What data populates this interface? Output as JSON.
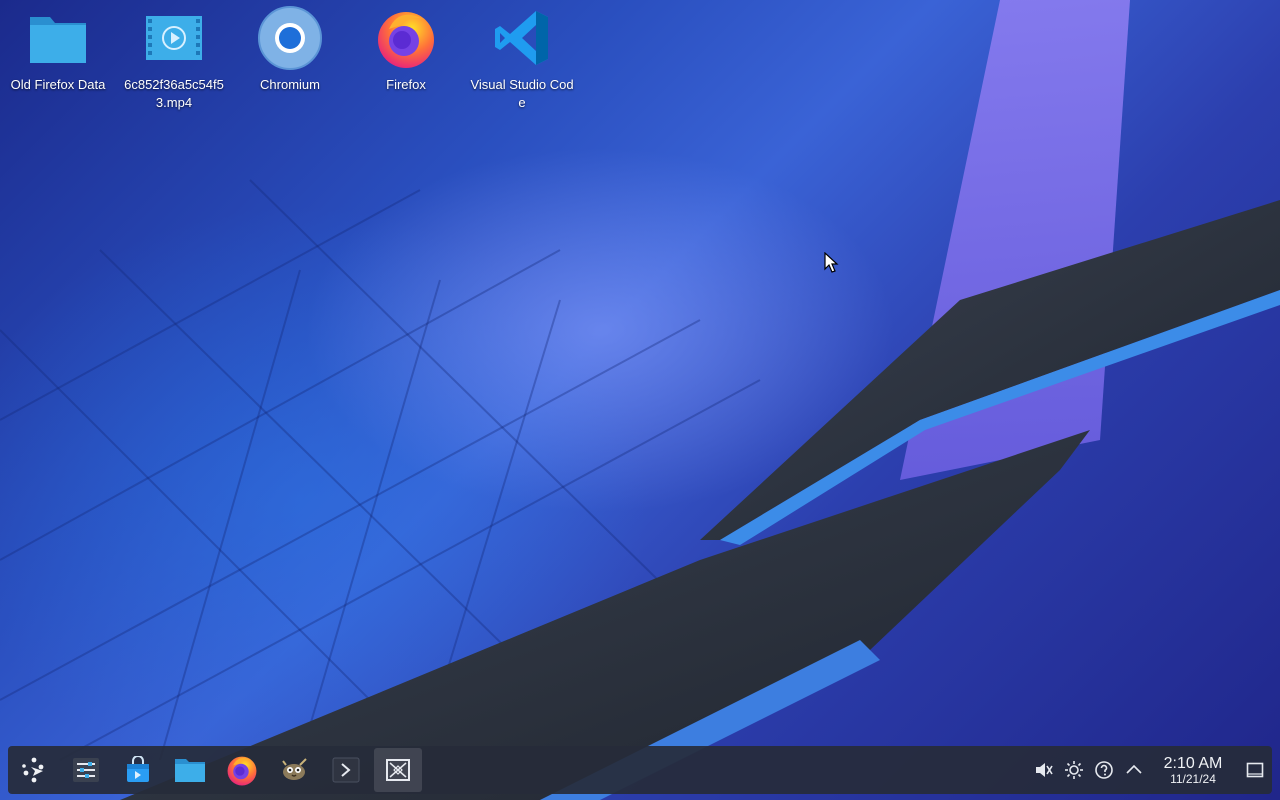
{
  "desktop": {
    "icons": [
      {
        "label": "Old Firefox Data",
        "icon": "folder-icon"
      },
      {
        "label": "6c852f36a5c54f53.mp4",
        "icon": "video-file-icon"
      },
      {
        "label": "Chromium",
        "icon": "chromium-icon"
      },
      {
        "label": "Firefox",
        "icon": "firefox-icon"
      },
      {
        "label": "Visual Studio Code",
        "icon": "vscode-icon"
      }
    ]
  },
  "taskbar": {
    "apps": [
      {
        "name": "Application Launcher",
        "icon": "app-launcher-icon"
      },
      {
        "name": "System Settings",
        "icon": "settings-sliders-icon"
      },
      {
        "name": "Discover",
        "icon": "store-bag-icon"
      },
      {
        "name": "Dolphin",
        "icon": "folder-icon"
      },
      {
        "name": "Firefox",
        "icon": "firefox-icon"
      },
      {
        "name": "GIMP",
        "icon": "gimp-icon"
      },
      {
        "name": "Konsole",
        "icon": "terminal-icon"
      },
      {
        "name": "Screenshot",
        "icon": "screenshot-icon",
        "active": true
      }
    ],
    "tray": {
      "icons": [
        "volume-muted-icon",
        "brightness-icon",
        "help-icon",
        "expand-tray-icon"
      ],
      "time": "2:10 AM",
      "date": "11/21/24"
    }
  },
  "colors": {
    "taskbar_bg": "#262b3a",
    "folder_blue": "#3daee9",
    "accent": "#3d8fe0"
  }
}
